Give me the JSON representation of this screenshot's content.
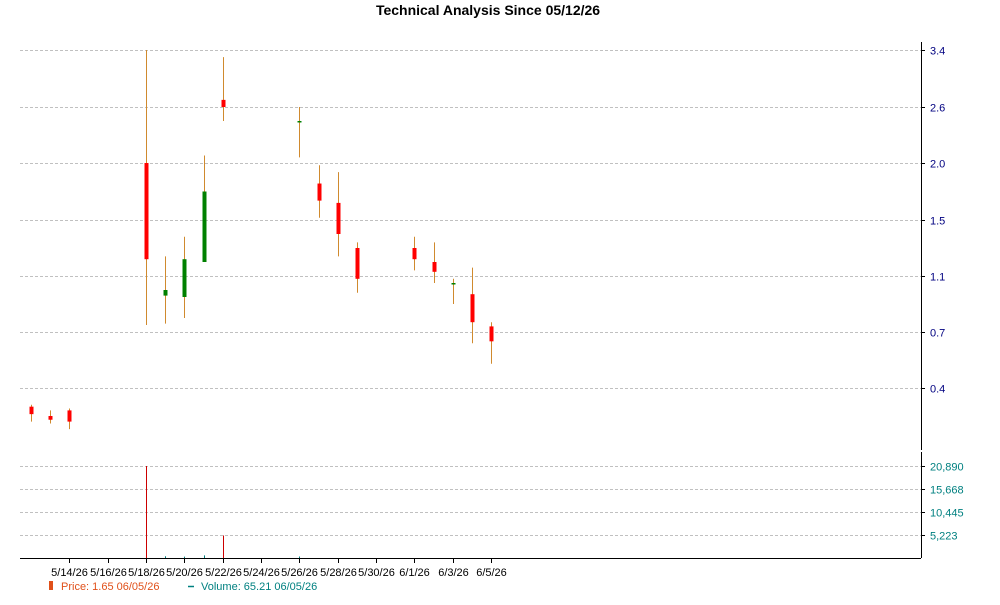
{
  "chart_data": {
    "type": "candlestick",
    "title": "Technical Analysis Since 05/12/26",
    "grid": true,
    "colors": {
      "up": "#008000",
      "down": "#ff0000",
      "wick": "#d08a2e",
      "volume_down": "#cc0000",
      "volume_up": "#008080",
      "price_axis_labels": "#000080",
      "volume_axis_labels": "#008080",
      "legend_price": "#e0501a",
      "legend_volume": "#008080",
      "grid": "#c0c0c0"
    },
    "price_axis": {
      "ticks": [
        0.4,
        0.7,
        1.1,
        1.5,
        2.0,
        2.6,
        3.4
      ],
      "tick_labels": [
        "0.4",
        "0.7",
        "1.1",
        "1.5",
        "2.0",
        "2.6",
        "3.4"
      ]
    },
    "volume_axis": {
      "ticks": [
        5223,
        10445,
        15668,
        20890
      ],
      "tick_labels": [
        "5,223",
        "10,445",
        "15,668",
        "20,890"
      ],
      "ylim": [
        0,
        23000
      ]
    },
    "x_axis": {
      "start": "2026-05-12",
      "end": "2026-06-05",
      "tick_dates": [
        "2026-05-14",
        "2026-05-16",
        "2026-05-18",
        "2026-05-20",
        "2026-05-22",
        "2026-05-24",
        "2026-05-26",
        "2026-05-28",
        "2026-05-30",
        "2026-06-01",
        "2026-06-03",
        "2026-06-05"
      ],
      "tick_labels": [
        "5/14/26",
        "5/16/26",
        "5/18/26",
        "5/20/26",
        "5/22/26",
        "5/24/26",
        "5/26/26",
        "5/28/26",
        "5/30/26",
        "6/1/26",
        "6/3/26",
        "6/5/26"
      ]
    },
    "candles": [
      {
        "date": "2026-05-12",
        "open": 0.3,
        "high": 0.31,
        "low": 0.22,
        "close": 0.26
      },
      {
        "date": "2026-05-13",
        "open": 0.25,
        "high": 0.28,
        "low": 0.21,
        "close": 0.23
      },
      {
        "date": "2026-05-14",
        "open": 0.28,
        "high": 0.29,
        "low": 0.18,
        "close": 0.22
      },
      {
        "date": "2026-05-18",
        "open": 2.0,
        "high": 3.4,
        "low": 0.75,
        "close": 1.22
      },
      {
        "date": "2026-05-19",
        "open": 0.96,
        "high": 1.24,
        "low": 0.76,
        "close": 1.0
      },
      {
        "date": "2026-05-20",
        "open": 0.95,
        "high": 1.38,
        "low": 0.8,
        "close": 1.22
      },
      {
        "date": "2026-05-21",
        "open": 1.2,
        "high": 2.08,
        "low": 1.2,
        "close": 1.75
      },
      {
        "date": "2026-05-22",
        "open": 2.7,
        "high": 3.3,
        "low": 2.45,
        "close": 2.6
      },
      {
        "date": "2026-05-26",
        "open": 2.45,
        "high": 2.6,
        "low": 2.06,
        "close": 2.45
      },
      {
        "date": "2026-05-27",
        "open": 1.82,
        "high": 1.98,
        "low": 1.52,
        "close": 1.67
      },
      {
        "date": "2026-05-28",
        "open": 1.65,
        "high": 1.92,
        "low": 1.24,
        "close": 1.4
      },
      {
        "date": "2026-05-29",
        "open": 1.3,
        "high": 1.34,
        "low": 0.98,
        "close": 1.08
      },
      {
        "date": "2026-06-01",
        "open": 1.3,
        "high": 1.38,
        "low": 1.14,
        "close": 1.22
      },
      {
        "date": "2026-06-02",
        "open": 1.2,
        "high": 1.34,
        "low": 1.05,
        "close": 1.13
      },
      {
        "date": "2026-06-03",
        "open": 1.04,
        "high": 1.08,
        "low": 0.9,
        "close": 1.05
      },
      {
        "date": "2026-06-04",
        "open": 0.97,
        "high": 1.16,
        "low": 0.64,
        "close": 0.77
      },
      {
        "date": "2026-06-05",
        "open": 0.74,
        "high": 0.77,
        "low": 0.53,
        "close": 0.65
      }
    ],
    "volume": [
      {
        "date": "2026-05-18",
        "value": 20890,
        "direction": "down"
      },
      {
        "date": "2026-05-19",
        "value": 400,
        "direction": "up"
      },
      {
        "date": "2026-05-20",
        "value": 300,
        "direction": "up"
      },
      {
        "date": "2026-05-21",
        "value": 600,
        "direction": "up"
      },
      {
        "date": "2026-05-22",
        "value": 5100,
        "direction": "down"
      },
      {
        "date": "2026-05-26",
        "value": 350,
        "direction": "up"
      }
    ],
    "legend": [
      {
        "marker": "candle",
        "label": "Price: 1.65  06/05/26",
        "color_key": "legend_price"
      },
      {
        "marker": "dash",
        "label": "Volume: 65.21  06/05/26",
        "color_key": "legend_volume"
      }
    ]
  }
}
